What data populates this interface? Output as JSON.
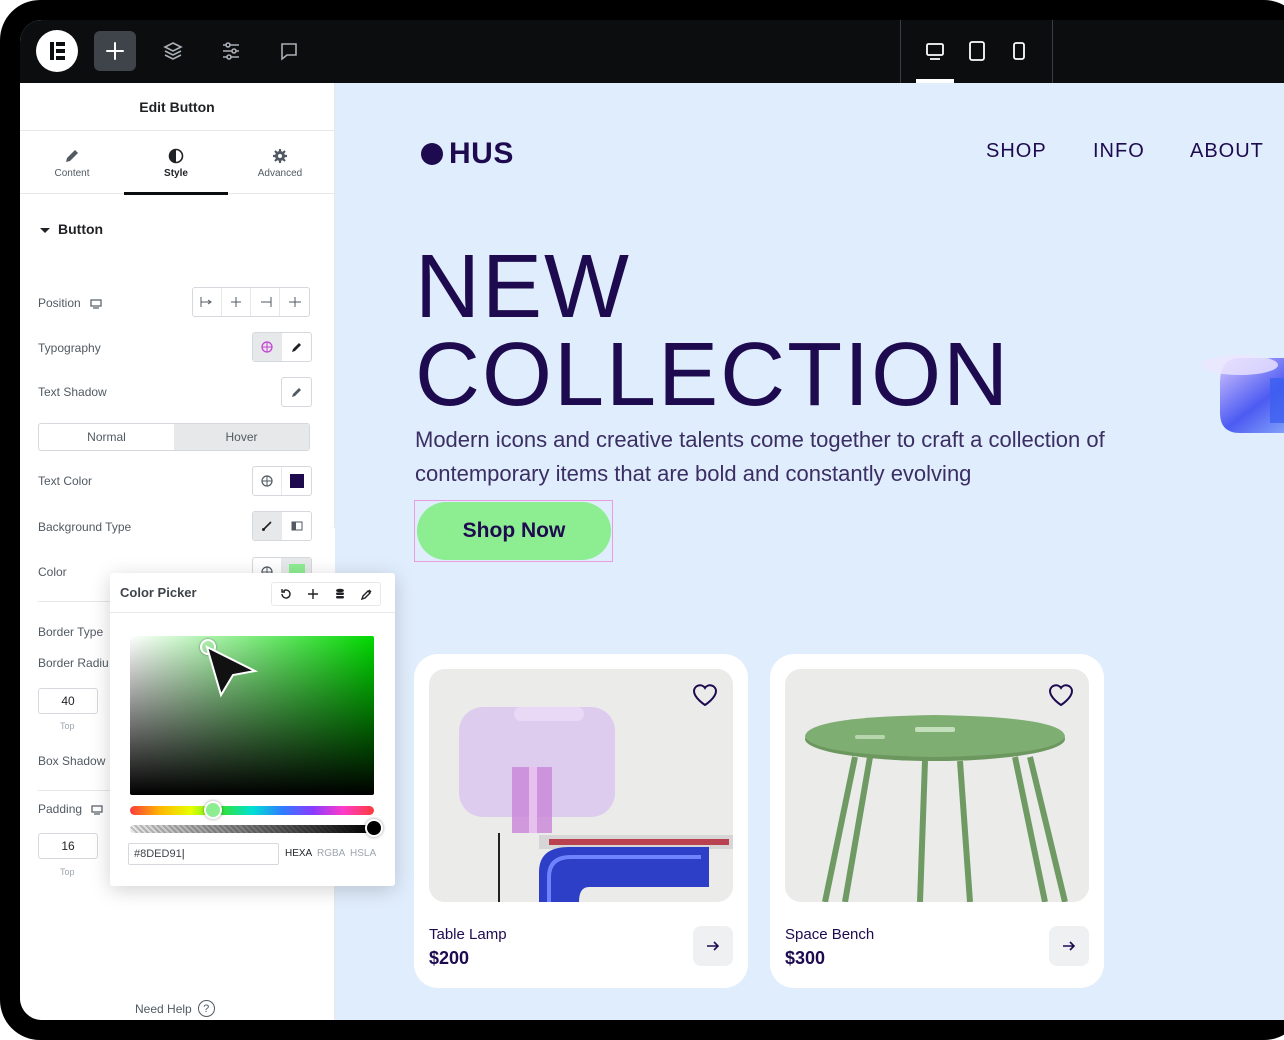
{
  "editor": {
    "panel_title": "Edit Button",
    "tabs": [
      {
        "label": "Content",
        "icon": "pencil-icon"
      },
      {
        "label": "Style",
        "icon": "contrast-icon"
      },
      {
        "label": "Advanced",
        "icon": "gear-icon"
      }
    ],
    "active_tab": "Style",
    "section_title": "Button",
    "labels": {
      "position": "Position",
      "typography": "Typography",
      "text_shadow": "Text Shadow",
      "text_color": "Text Color",
      "background_type": "Background Type",
      "color": "Color",
      "border_type": "Border Type",
      "border_radius": "Border Radiu",
      "box_shadow": "Box Shadow",
      "padding": "Padding"
    },
    "state_tabs": {
      "normal": "Normal",
      "hover": "Hover",
      "active": "Hover"
    },
    "text_color_value": "#1e0a4f",
    "color_value": "#8ded91",
    "border_radius": {
      "top": "40",
      "caption": "Top"
    },
    "padding": {
      "top": "16",
      "caption": "Top"
    },
    "need_help": "Need Help",
    "help_icon": "?"
  },
  "color_picker": {
    "title": "Color Picker",
    "hex_value": "#8DED91",
    "formats": [
      "HEXA",
      "RGBA",
      "HSLA"
    ],
    "active_format": "HEXA"
  },
  "site": {
    "brand": "HUS",
    "nav": [
      "SHOP",
      "INFO",
      "ABOUT"
    ],
    "hero_line1": "NEW",
    "hero_line2": "COLLECTION",
    "hero_sub": "Modern icons and creative talents come together to craft a collection of contemporary items that are bold and constantly evolving",
    "cta": "Shop Now",
    "products": [
      {
        "name": "Table Lamp",
        "price": "$200"
      },
      {
        "name": "Space Bench",
        "price": "$300"
      }
    ]
  },
  "colors": {
    "accent_green": "#8ded91",
    "brand_purple": "#1e0a4f",
    "canvas_bg": "#e0edfc",
    "topbar_bg": "#0c0d0e"
  }
}
